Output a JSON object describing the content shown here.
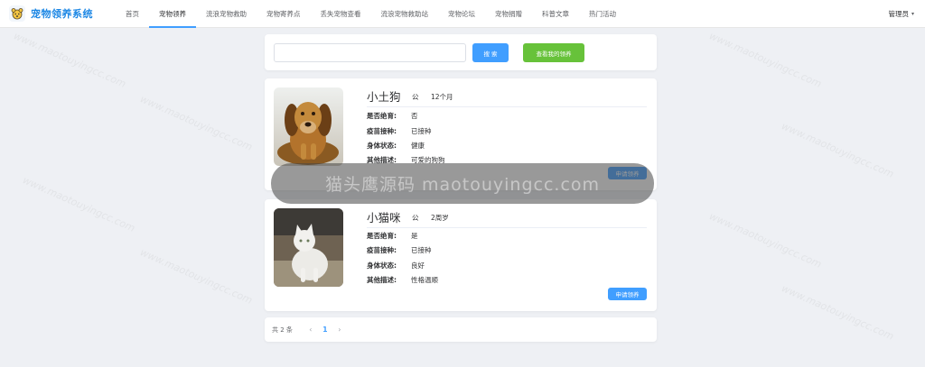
{
  "app": {
    "title": "宠物领养系统",
    "logo_icon": "pet-face-icon"
  },
  "nav": {
    "items": [
      {
        "label": "首页",
        "active": false
      },
      {
        "label": "宠物领养",
        "active": true
      },
      {
        "label": "流浪宠物救助",
        "active": false
      },
      {
        "label": "宠物寄养点",
        "active": false
      },
      {
        "label": "丢失宠物查看",
        "active": false
      },
      {
        "label": "流浪宠物救助站",
        "active": false
      },
      {
        "label": "宠物论坛",
        "active": false
      },
      {
        "label": "宠物捐赠",
        "active": false
      },
      {
        "label": "科普文章",
        "active": false
      },
      {
        "label": "热门活动",
        "active": false
      }
    ],
    "user": "管理员"
  },
  "search": {
    "value": "",
    "placeholder": "",
    "search_button": "搜 索",
    "my_adoption_button": "查看我的领养"
  },
  "pets": [
    {
      "name": "小土狗",
      "gender": "公",
      "age": "12个月",
      "fields": [
        {
          "label": "是否绝育:",
          "value": "否"
        },
        {
          "label": "疫苗接种:",
          "value": "已接种"
        },
        {
          "label": "身体状态:",
          "value": "健康"
        },
        {
          "label": "其他描述:",
          "value": "可爱的狗狗"
        }
      ],
      "apply_button": "申请领养"
    },
    {
      "name": "小猫咪",
      "gender": "公",
      "age": "2周岁",
      "fields": [
        {
          "label": "是否绝育:",
          "value": "是"
        },
        {
          "label": "疫苗接种:",
          "value": "已接种"
        },
        {
          "label": "身体状态:",
          "value": "良好"
        },
        {
          "label": "其他描述:",
          "value": "性格温顺"
        }
      ],
      "apply_button": "申请领养"
    }
  ],
  "pagination": {
    "total_text": "共 2 条",
    "current_page": "1",
    "prev_icon": "chevron-left-icon",
    "next_icon": "chevron-right-icon"
  },
  "watermark": {
    "band_text": "猫头鹰源码 maotouyingcc.com",
    "tile_text": "www.maotouyingcc.com"
  },
  "colors": {
    "primary": "#409eff",
    "success": "#67c23a",
    "brand": "#1e88e5",
    "background": "#eef0f4"
  }
}
